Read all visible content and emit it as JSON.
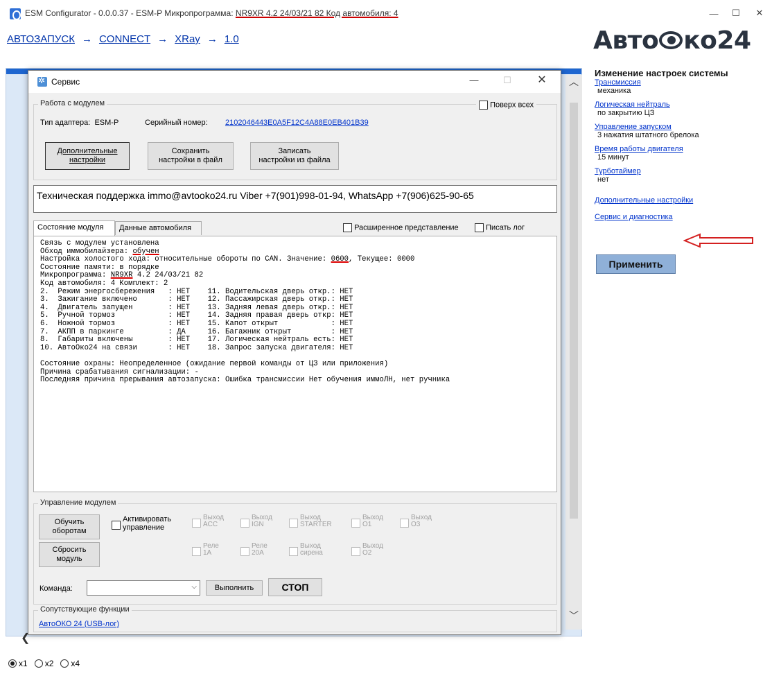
{
  "window": {
    "title_prefix": "ESM Configurator - 0.0.0.37 - ESM-P  Микропрограмма: ",
    "title_firmware": "NR9XR 4.2 24/03/21 82 Код автомобиля: 4",
    "minimize": "—",
    "maximize": "☐",
    "close": "✕"
  },
  "breadcrumb": {
    "items": [
      "АВТОЗАПУСК",
      "CONNECT",
      "XRay",
      "1.0"
    ],
    "separator": "→"
  },
  "logo": {
    "left": "Авто",
    "right": "ко24"
  },
  "settings": {
    "heading": "Изменение настроек системы",
    "items": [
      {
        "label": "Трансмиссия",
        "value": "механика"
      },
      {
        "label": "Логическая нейтраль",
        "value": "по закрытию ЦЗ"
      },
      {
        "label": "Управление запуском",
        "value": "3 нажатия штатного брелока"
      },
      {
        "label": "Время работы двигателя",
        "value": "15 минут"
      },
      {
        "label": "Турботаймер",
        "value": "нет"
      }
    ],
    "extra_link": "Дополнительные настройки",
    "service_link": "Сервис и диагностика",
    "apply_label": "Применить",
    "arrow_color": "#d42020"
  },
  "zoom": {
    "options": [
      "x1",
      "x2",
      "x4"
    ],
    "selected": "x1"
  },
  "dialog": {
    "title": "Сервис",
    "module_group": "Работа с модулем",
    "on_top_label": "Поверх всех",
    "adapter_label": "Тип адаптера:",
    "adapter_value": "ESM-P",
    "serial_label": "Серийный номер:",
    "serial_value": "2102046443E0A5F12C4A88E0EB401B39",
    "btn_extra_line1": "Дополнительные",
    "btn_extra_line2": "настройки",
    "btn_save_line1": "Сохранить",
    "btn_save_line2": "настройки в файл",
    "btn_load_line1": "Записать",
    "btn_load_line2": "настройки из файла",
    "support_text": "Техническая поддержка immo@avtooko24.ru     Viber +7(901)998-01-94, WhatsApp +7(906)625-90-65",
    "tab_state": "Состояние модуля",
    "tab_car": "Данные автомобиля",
    "extended_label": "Расширенное представление",
    "log_label": "Писать лог",
    "console": {
      "l1": "Связь с модулем установлена",
      "l2a": "Обход иммобилайзера: ",
      "l2b": "обучен",
      "l3a": "Настройка холостого хода: относительные обороты по CAN. Значение: ",
      "l3b": "0600",
      "l3c": ", Текущее: 0000",
      "l4": "Состояние памяти: в порядке",
      "l5a": "Микропрограмма: ",
      "l5b": "NR9XR",
      "l5c": " 4.2 24/03/21 82",
      "l6": "Код автомобиля: 4 Комплект: 2",
      "rows": [
        "2.  Режим энергосбережения   : НЕТ    11. Водительская дверь откр.: НЕТ",
        "3.  Зажигание включено       : НЕТ    12. Пассажирская дверь откр.: НЕТ",
        "4.  Двигатель запущен        : НЕТ    13. Задняя левая дверь откр.: НЕТ",
        "5.  Ручной тормоз            : НЕТ    14. Задняя правая дверь откр: НЕТ",
        "6.  Ножной тормоз            : НЕТ    15. Капот открыт            : НЕТ",
        "7.  АКПП в паркинге          : ДА     16. Багажник открыт         : НЕТ",
        "8.  Габариты включены        : НЕТ    17. Логическая нейтраль есть: НЕТ",
        "10. АвтоОко24 на связи       : НЕТ    18. Запрос запуска двигателя: НЕТ"
      ],
      "l_guard": "Состояние охраны: Неопределенное (ожидание первой команды от ЦЗ или приложения)",
      "l_reason": "Причина срабатывания сигнализации: -",
      "l_last": "Последняя причина прерывания автозапуска: Ошибка трансмиссии Нет обучения иммоЛН, нет ручника"
    },
    "control_group": "Управление модулем",
    "btn_learn_line1": "Обучить",
    "btn_learn_line2": "оборотам",
    "btn_reset_line1": "Сбросить",
    "btn_reset_line2": "модуль",
    "activate_line1": "Активировать",
    "activate_line2": "управление",
    "outputs_top": [
      {
        "l1": "Выход",
        "l2": "ACC"
      },
      {
        "l1": "Выход",
        "l2": "IGN"
      },
      {
        "l1": "Выход",
        "l2": "STARTER"
      },
      {
        "l1": "Выход",
        "l2": "O1"
      },
      {
        "l1": "Выход",
        "l2": "O3"
      }
    ],
    "outputs_bottom": [
      {
        "l1": "Реле",
        "l2": "1A"
      },
      {
        "l1": "Реле",
        "l2": "20A"
      },
      {
        "l1": "Выход",
        "l2": "сирена"
      },
      {
        "l1": "Выход",
        "l2": "O2"
      }
    ],
    "command_label": "Команда:",
    "command_value": "",
    "execute_label": "Выполнить",
    "stop_label": "СТОП",
    "related_group": "Сопутствующие функции",
    "related_link": "АвтоОКО 24 (USB-лог)"
  }
}
